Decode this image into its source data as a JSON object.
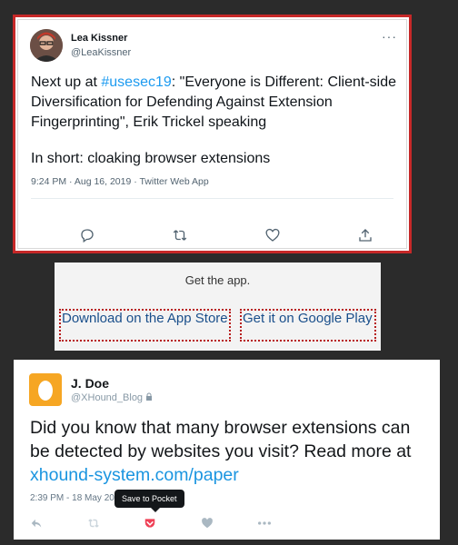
{
  "tweet1": {
    "author": "Lea Kissner",
    "handle": "@LeaKissner",
    "more_label": "···",
    "text_before": "Next up at ",
    "hashtag": "#usesec19",
    "text_after": ": \"Everyone is Different: Client-side Diversification for Defending Against Extension Fingerprinting\", Erik Trickel speaking",
    "text_p2": "In short: cloaking browser extensions",
    "meta": "9:24 PM · Aug 16, 2019 · Twitter Web App",
    "actions": [
      "reply-icon",
      "retweet-icon",
      "like-icon",
      "share-icon"
    ]
  },
  "get_app": {
    "title": "Get the app.",
    "ios_label": "Download on the App Store",
    "android_label": "Get it on Google Play"
  },
  "tweet2": {
    "author": "J. Doe",
    "handle": "@XHound_Blog",
    "text_before": "Did you know that many browser extensions can be detected by websites you visit? Read more at ",
    "link": "xhound-system.com/paper",
    "meta": "2:39 PM - 18 May 20",
    "tooltip": "Save to Pocket",
    "actions": [
      "reply-icon",
      "retweet-icon",
      "pocket-icon",
      "like-icon",
      "more-icon"
    ],
    "colors": {
      "pocket": "#ef4056"
    }
  }
}
